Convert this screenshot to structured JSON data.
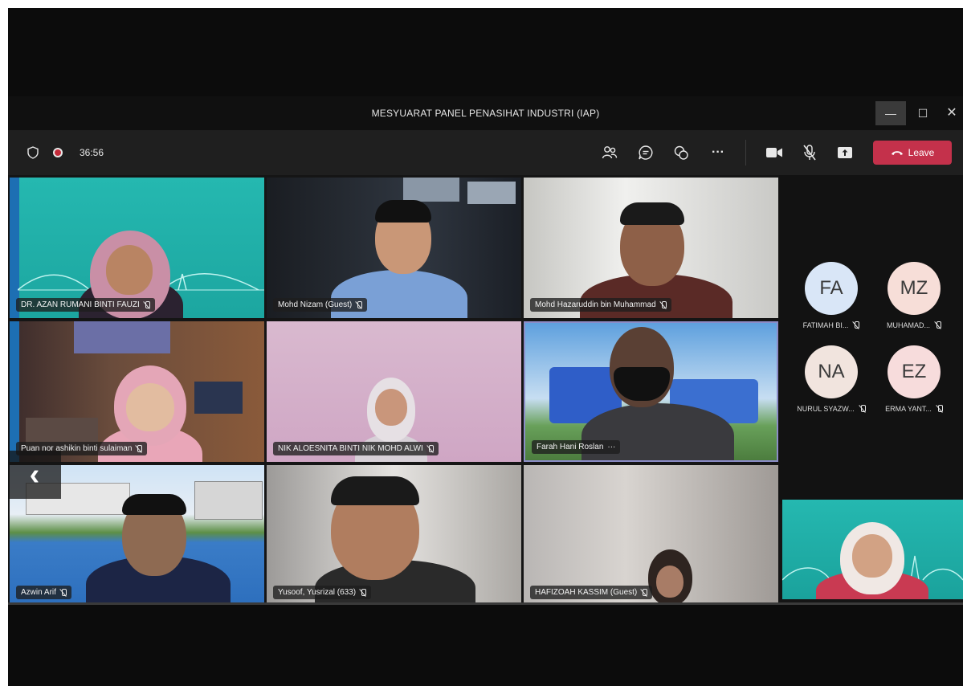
{
  "window": {
    "title": "MESYUARAT PANEL PENASIHAT INDUSTRI (IAP)",
    "minimize_glyph": "—",
    "maximize_glyph": "☐",
    "close_glyph": "✕"
  },
  "toolbar": {
    "timer": "36:56",
    "leave_label": "Leave",
    "icons": [
      "shield-icon",
      "record-icon",
      "people-icon",
      "chat-icon",
      "reactions-icon",
      "more-icon",
      "camera-icon",
      "mic-off-icon",
      "share-icon",
      "phone-icon"
    ],
    "colors": {
      "leave": "#c4314b",
      "record": "#c42b3a",
      "accent": "#6264a7"
    }
  },
  "tiles": [
    {
      "name": "DR. AZAN RUMANI BINTI FAUZI",
      "muted": true
    },
    {
      "name": "Mohd Nizam (Guest)",
      "muted": true
    },
    {
      "name": "Mohd Hazaruddin bin Muhammad",
      "muted": true
    },
    {
      "name": "Puan nor ashikin binti sulaiman",
      "muted": true
    },
    {
      "name": "NIK ALOESNITA BINTI NIK MOHD ALWI",
      "muted": true
    },
    {
      "name": "Farah Hani Roslan",
      "more": "···",
      "active": true
    },
    {
      "name": "Azwin Arif",
      "muted": true
    },
    {
      "name": "Yusoof, Yusrizal (633)",
      "muted": true
    },
    {
      "name": "HAFIZOAH KASSIM (Guest)",
      "muted": true
    }
  ],
  "side_participants": [
    {
      "initials": "FA",
      "name": "FATIMAH BI...",
      "color": "#d9e6f7"
    },
    {
      "initials": "MZ",
      "name": "MUHAMAD...",
      "color": "#f7ded8"
    },
    {
      "initials": "NA",
      "name": "NURUL SYAZW...",
      "color": "#f1e4de"
    },
    {
      "initials": "EZ",
      "name": "ERMA YANT...",
      "color": "#f7dcdc"
    }
  ],
  "nav": {
    "prev_glyph": "‹"
  }
}
